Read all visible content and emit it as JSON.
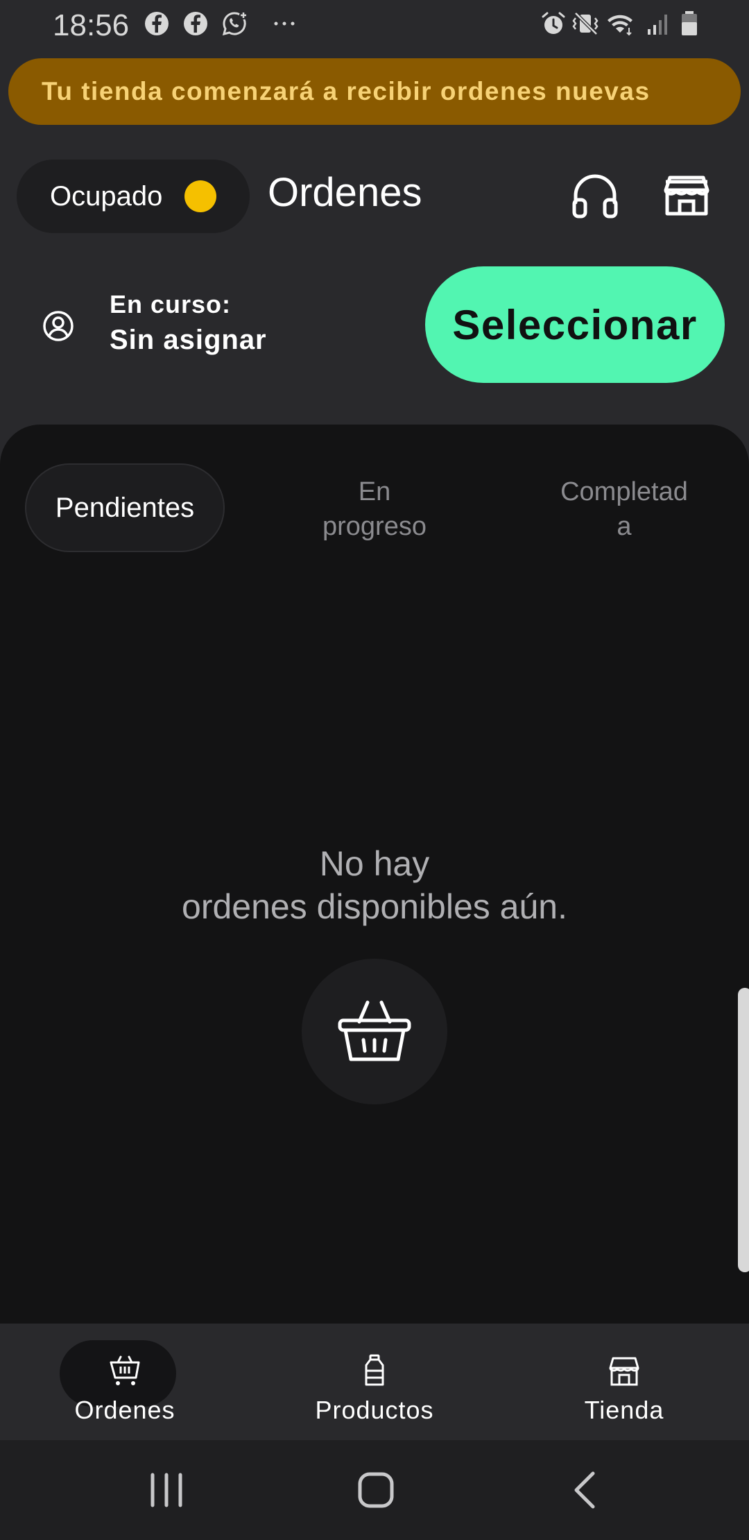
{
  "status_bar": {
    "time": "18:56",
    "left_icons": [
      "facebook-icon",
      "facebook-icon",
      "whatsapp-icon",
      "more-notifications-icon"
    ],
    "right_icons": [
      "alarm-icon",
      "vibrate-icon",
      "wifi-icon",
      "signal-icon",
      "battery-icon"
    ]
  },
  "banner": {
    "text": "Tu tienda comenzará a recibir ordenes nuevas"
  },
  "header": {
    "status_label": "Ocupado",
    "status_color": "#f5c000",
    "title": "Ordenes",
    "icons": [
      "headset-icon",
      "store-icon"
    ]
  },
  "assignment": {
    "label": "En curso:",
    "value": "Sin asignar",
    "button_label": "Seleccionar",
    "button_color": "#52f5b1"
  },
  "tabs": [
    {
      "label": "Pendientes",
      "active": true
    },
    {
      "label": "En\nprogreso",
      "active": false
    },
    {
      "label": "Completad\na",
      "active": false
    }
  ],
  "empty_state": {
    "message": "No hay\nordenes disponibles aún.",
    "icon": "basket-icon"
  },
  "bottom_nav": [
    {
      "label": "Ordenes",
      "icon": "cart-icon",
      "active": true
    },
    {
      "label": "Productos",
      "icon": "bottle-icon",
      "active": false
    },
    {
      "label": "Tienda",
      "icon": "store-icon",
      "active": false
    }
  ],
  "system_nav": [
    "recent-apps-button",
    "home-button",
    "back-button"
  ]
}
